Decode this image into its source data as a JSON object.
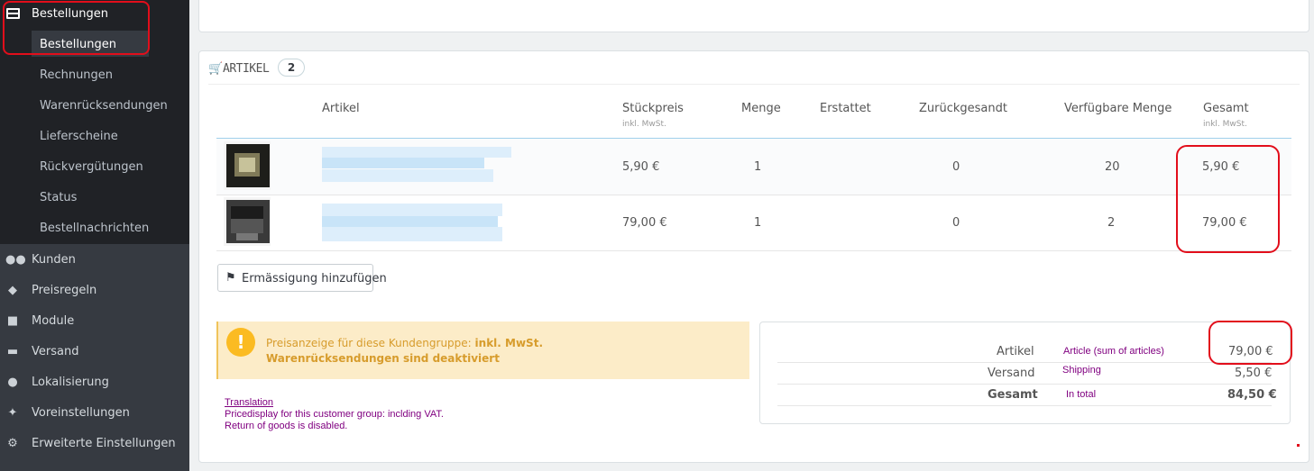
{
  "sidebar": {
    "active_section": "Bestellungen",
    "sub_items": [
      {
        "label": "Bestellungen"
      },
      {
        "label": "Rechnungen"
      },
      {
        "label": "Warenrücksendungen"
      },
      {
        "label": "Lieferscheine"
      },
      {
        "label": "Rückvergütungen"
      },
      {
        "label": "Status"
      },
      {
        "label": "Bestellnachrichten"
      }
    ],
    "items": [
      {
        "label": "Kunden",
        "icon": "users-icon"
      },
      {
        "label": "Preisregeln",
        "icon": "tags-icon"
      },
      {
        "label": "Module",
        "icon": "puzzle-icon"
      },
      {
        "label": "Versand",
        "icon": "truck-icon"
      },
      {
        "label": "Lokalisierung",
        "icon": "globe-icon"
      },
      {
        "label": "Voreinstellungen",
        "icon": "wrench-icon"
      },
      {
        "label": "Erweiterte Einstellungen",
        "icon": "cogs-icon"
      }
    ]
  },
  "panel": {
    "title": "ARTIKEL",
    "count": "2",
    "columns": {
      "artikel": "Artikel",
      "stueckpreis": "Stückpreis",
      "stueckpreis_sub": "inkl. MwSt.",
      "menge": "Menge",
      "erstattet": "Erstattet",
      "zurueck": "Zurückgesandt",
      "verfuegbar": "Verfügbare Menge",
      "gesamt": "Gesamt",
      "gesamt_sub": "inkl. MwSt."
    },
    "rows": [
      {
        "price": "5,90 €",
        "qty": "1",
        "returned": "0",
        "available": "20",
        "total": "5,90 €"
      },
      {
        "price": "79,00 €",
        "qty": "1",
        "returned": "0",
        "available": "2",
        "total": "79,00 €"
      }
    ],
    "discount_button": "Ermässigung hinzufügen",
    "alert": {
      "line1_prefix": "Preisanzeige für diese Kundengruppe: ",
      "line1_bold": "inkl. MwSt.",
      "line2": "Warenrücksendungen sind deaktiviert"
    },
    "translation": {
      "title": "Translation",
      "line1": "Pricedisplay for this customer group: inclding VAT.",
      "line2": "Return of goods is disabled."
    },
    "totals": [
      {
        "label": "Artikel",
        "annotation": "Article (sum of articles)",
        "value": "79,00 €"
      },
      {
        "label": "Versand",
        "annotation": "Shipping",
        "value": "5,50 €"
      },
      {
        "label": "Gesamt",
        "annotation": "In total",
        "value": "84,50 €"
      }
    ]
  },
  "colors": {
    "sidebar_bg": "#363a41",
    "highlight_red": "#e20e1b",
    "alert_bg": "#fcecc8",
    "alert_text": "#d79c2c",
    "annotation_purple": "#800080"
  }
}
